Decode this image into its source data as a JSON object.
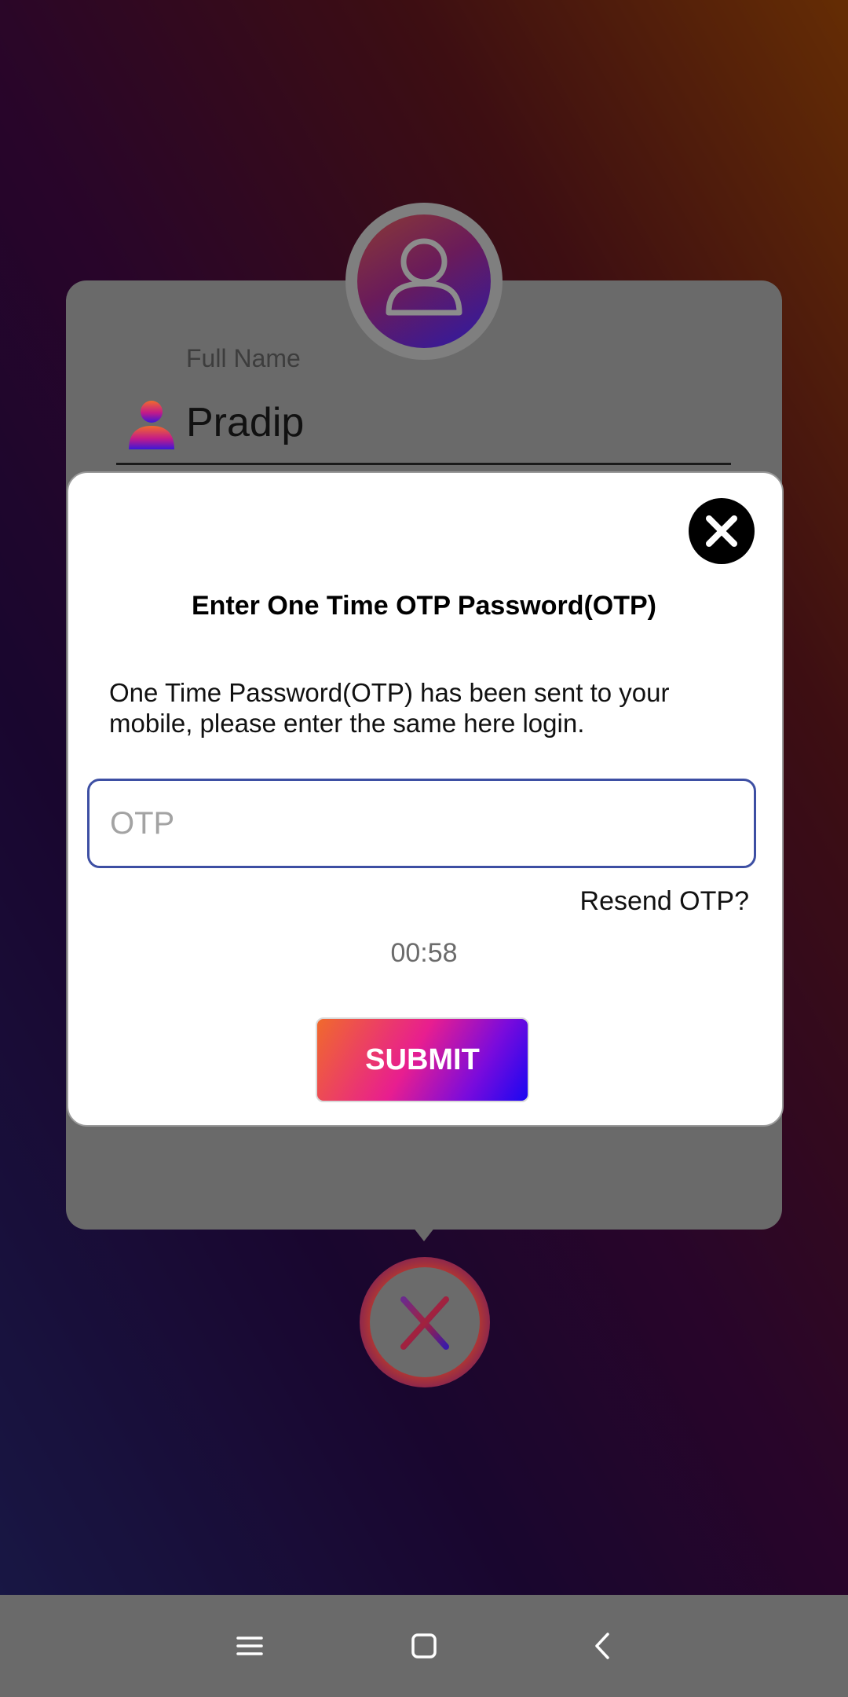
{
  "profile": {
    "name_label": "Full Name",
    "name_value": "Pradip"
  },
  "dialog": {
    "title": "Enter One Time OTP Password(OTP)",
    "message": "One Time Password(OTP) has been sent to your mobile, please enter the same here login.",
    "otp_placeholder": "OTP",
    "otp_value": "",
    "resend_label": "Resend OTP?",
    "timer": "00:58",
    "submit_label": "SUBMIT"
  },
  "icons": {
    "avatar": "user-icon",
    "name_field": "person-icon",
    "dialog_close": "close-icon",
    "cancel": "x-icon",
    "nav_menu": "menu-icon",
    "nav_home": "home-icon",
    "nav_back": "back-icon"
  },
  "colors": {
    "submit_gradient_start": "#f06a2c",
    "submit_gradient_end": "#1a07f2",
    "otp_border": "#3d4fa3"
  }
}
